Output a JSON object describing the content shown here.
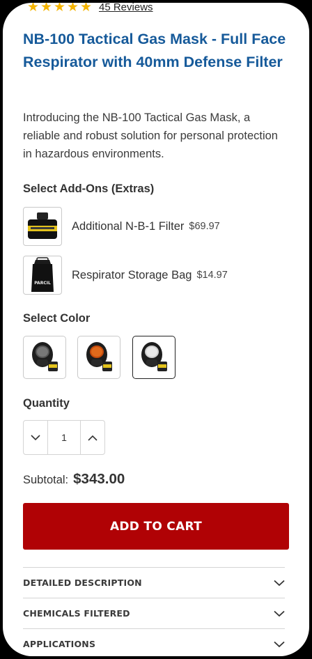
{
  "rating": {
    "reviews_text": "45 Reviews",
    "stars": 5
  },
  "product": {
    "title": "NB-100 Tactical Gas Mask - Full Face Respirator with 40mm Defense Filter",
    "intro": "Introducing the NB-100 Tactical Gas Mask, a reliable and robust solution for personal protection in hazardous environments."
  },
  "addons": {
    "label": "Select Add-Ons (Extras)",
    "items": [
      {
        "name": "Additional N-B-1 Filter",
        "price": "$69.97"
      },
      {
        "name": "Respirator Storage Bag",
        "price": "$14.97"
      }
    ],
    "bag_text": "PARCIL"
  },
  "color": {
    "label": "Select Color"
  },
  "quantity": {
    "label": "Quantity",
    "value": "1"
  },
  "subtotal": {
    "label": "Subtotal:",
    "value": "$343.00"
  },
  "cart": {
    "button_label": "ADD TO CART"
  },
  "accordion": [
    {
      "label": "DETAILED DESCRIPTION"
    },
    {
      "label": "CHEMICALS FILTERED"
    },
    {
      "label": "APPLICATIONS"
    }
  ],
  "colors": {
    "title": "#165a9a",
    "button": "#b00205",
    "star": "#f5b400"
  }
}
